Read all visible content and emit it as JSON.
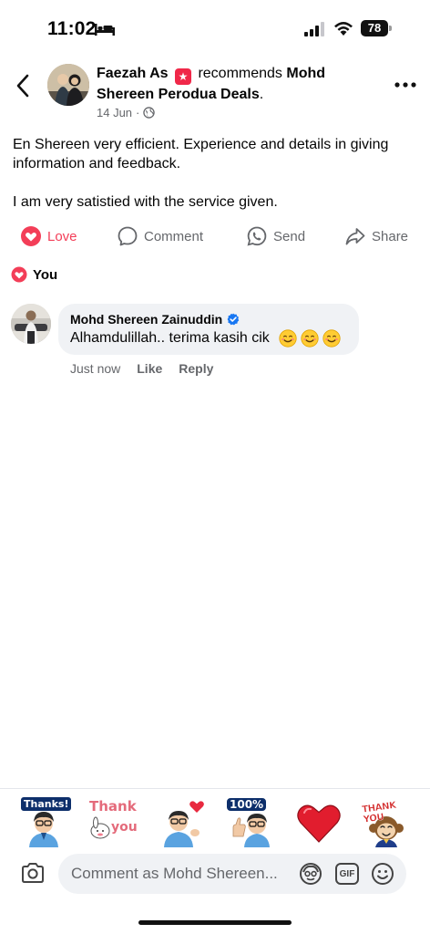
{
  "status_bar": {
    "time": "11:02",
    "battery": "78"
  },
  "post": {
    "author": "Faezah As",
    "recommends_text": "recommends",
    "page_name": "Mohd Shereen Perodua Deals",
    "page_suffix": ".",
    "date": "14 Jun",
    "date_separator": "·",
    "body_paragraphs": [
      "En Shereen very efficient. Experience and details in giving information and feedback.",
      "I am very satistied with the service given."
    ]
  },
  "actions": {
    "love": "Love",
    "comment": "Comment",
    "send": "Send",
    "share": "Share"
  },
  "reactions": {
    "label": "You"
  },
  "comment": {
    "name": "Mohd Shereen Zainuddin",
    "text": "Alhamdulillah.. terima kasih cik",
    "time": "Just now",
    "like": "Like",
    "reply": "Reply"
  },
  "stickers": {
    "thanks": "Thanks!",
    "thank_you_line1": "Thank",
    "thank_you_line2": "you",
    "hundred": "100%",
    "thank_you_monkey": "THANK YOU"
  },
  "composer": {
    "placeholder": "Comment as Mohd Shereen...",
    "gif": "GIF"
  },
  "colors": {
    "love_red": "#f33e58",
    "secondary_text": "#65676b",
    "verified_blue": "#1877f2",
    "bubble_bg": "#f0f2f5"
  }
}
